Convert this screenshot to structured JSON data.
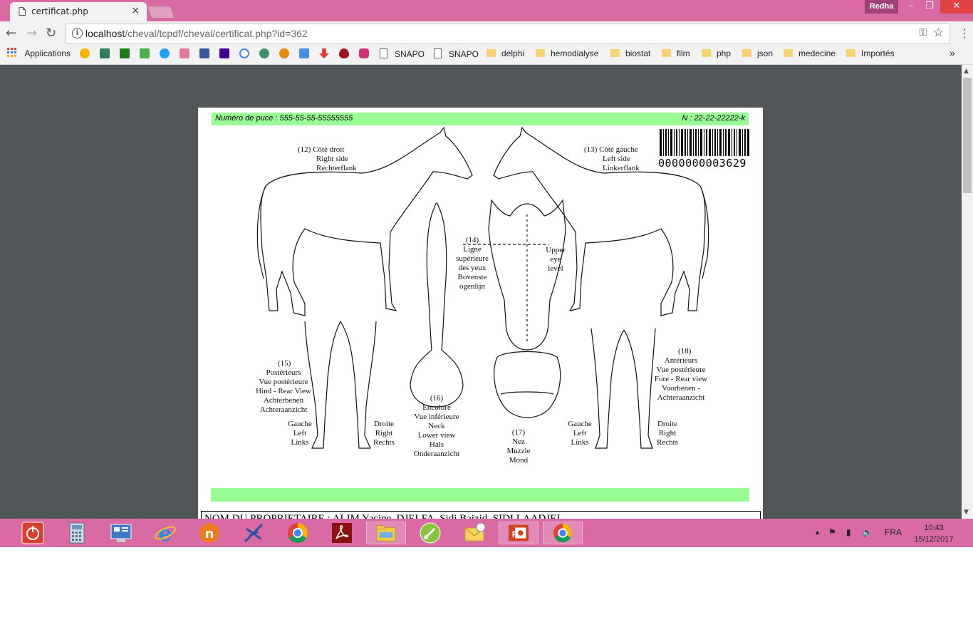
{
  "browser": {
    "tab_title": "certificat.php",
    "tab_close": "×",
    "user_name": "Redha",
    "url_host": "localhost",
    "url_path": "/cheval/tcpdf/cheval/certificat.php?id=362"
  },
  "bookmarks": {
    "apps_label": "Applications",
    "items": [
      "SNAPO",
      "SNAPO",
      "delphi",
      "hemodialyse",
      "biostat",
      "film",
      "php",
      "json",
      "medecine",
      "Importés"
    ],
    "overflow": "»"
  },
  "certificate": {
    "chip_number": "Numéro de puce : 555-55-55-55555555",
    "ref_number": "N : 22-22-22222-k",
    "barcode_number": "0000000003629",
    "owner_line": "NOM DU PROPRIETAIRE : ALIM Yacine, DJELFA, Sidi Baizid, SIDI LAADJEL",
    "labels": {
      "right_side": [
        "(12) Côté droit",
        "Right side",
        "Rechterflank"
      ],
      "left_side": [
        "(13) Côté gauche",
        "Left side",
        "Linkerflank"
      ],
      "eye_level": [
        "(14)",
        "Ligne",
        "supérieure",
        "des yeux",
        "Bovenste",
        "ogenlijn"
      ],
      "upper_eye": [
        "Upper",
        "eye",
        "level"
      ],
      "hind": [
        "(15)",
        "Postérieurs",
        "Vue postérieure",
        "Hind - Rear View",
        "Achterbenen",
        "Achteraanzicht"
      ],
      "neck": [
        "(16)",
        "Encolure",
        "Vue inférieure",
        "Neck",
        "Lower view",
        "Hals",
        "Onderaanzicht"
      ],
      "muzzle": [
        "(17)",
        "Nez",
        "Muzzle",
        "Mond"
      ],
      "fore": [
        "(18)",
        "Antérieurs",
        "Vue postérieure",
        "Fore - Rear view",
        "Voorbenen -",
        "Achteraanzicht"
      ],
      "hind_left": [
        "Gauche",
        "Left",
        "Links"
      ],
      "hind_right": [
        "Droite",
        "Right",
        "Rechts"
      ],
      "fore_left": [
        "Gauche",
        "Left",
        "Links"
      ],
      "fore_right": [
        "Droite",
        "Right",
        "Rechts"
      ]
    }
  },
  "taskbar": {
    "language": "FRA",
    "time": "10:43",
    "date": "15/12/2017"
  }
}
